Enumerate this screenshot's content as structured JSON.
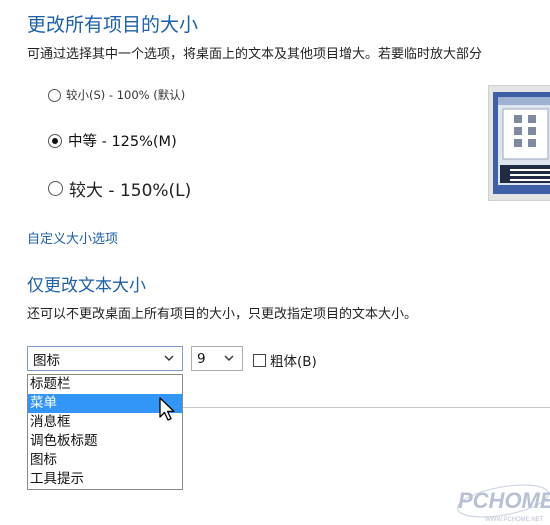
{
  "heading_all": "更改所有项目的大小",
  "desc_all": "可通过选择其中一个选项，将桌面上的文本及其他项目增大。若要临时放大部分",
  "radio_options": [
    {
      "label": "较小(S) - 100% (默认)",
      "selected": false
    },
    {
      "label": "中等 - 125%(M)",
      "selected": true
    },
    {
      "label": "较大 - 150%(L)",
      "selected": false
    }
  ],
  "custom_link": "自定义大小选项",
  "heading_text": "仅更改文本大小",
  "desc_text": "还可以不更改桌面上所有项目的大小，只更改指定项目的文本大小。",
  "item_select_value": "图标",
  "size_select_value": "9",
  "bold_label": "粗体(B)",
  "bold_checked": false,
  "dropdown_items": [
    "标题栏",
    "菜单",
    "消息框",
    "调色板标题",
    "图标",
    "工具提示"
  ],
  "dropdown_selected_index": 1,
  "icons": {
    "chevron": "chevron-down-icon",
    "cursor": "mouse-pointer-icon",
    "preview": "display-preview-icon"
  },
  "colors": {
    "heading": "#1e5fa9",
    "selection": "#3296f8"
  },
  "watermark": {
    "logo_text": "PCHOME",
    "url_text": "WWW.PCHOME.NET"
  }
}
